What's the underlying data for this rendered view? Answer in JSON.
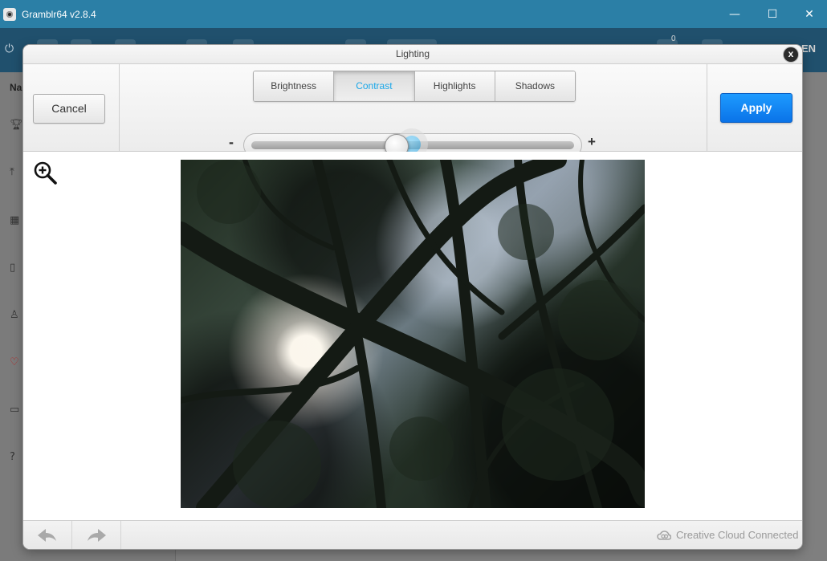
{
  "window": {
    "title": "Gramblr64 v2.8.4",
    "controls": {
      "minimize": "—",
      "maximize": "☐",
      "close": "✕"
    }
  },
  "appbar": {
    "notification_count": "0",
    "language": "EN"
  },
  "sidebar": {
    "title": "Na",
    "icons": [
      "trophy-icon",
      "upload-icon",
      "calendar-icon",
      "bookmark-icon",
      "user-icon",
      "heart-icon",
      "wallet-icon",
      "help-icon"
    ]
  },
  "dialog": {
    "title": "Lighting",
    "close_label": "x",
    "cancel_label": "Cancel",
    "apply_label": "Apply",
    "tabs": [
      {
        "label": "Brightness",
        "active": false
      },
      {
        "label": "Contrast",
        "active": true
      },
      {
        "label": "Highlights",
        "active": false
      },
      {
        "label": "Shadows",
        "active": false
      }
    ],
    "slider": {
      "minus_label": "-",
      "plus_label": "+",
      "value_fraction": 0.5
    },
    "footer": {
      "status": "Creative Cloud Connected"
    }
  },
  "colors": {
    "accent": "#1aa7e8",
    "apply": "#0a73e8",
    "titlebar": "#2b7fa6"
  }
}
